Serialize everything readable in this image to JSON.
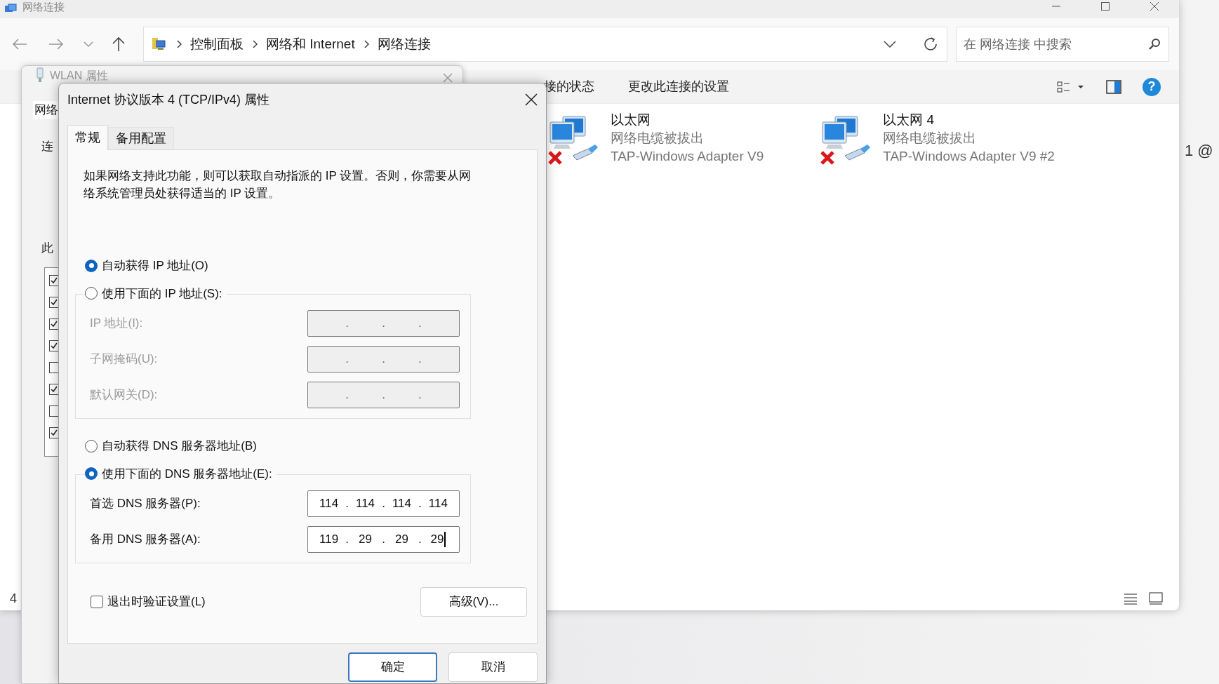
{
  "explorer": {
    "title": "网络连接",
    "breadcrumb": [
      "控制面板",
      "网络和 Internet",
      "网络连接"
    ],
    "search": {
      "placeholder": "在 网络连接 中搜索"
    },
    "commands": [
      "接的状态",
      "更改此连接的设置"
    ],
    "help_label": "?",
    "connections": [
      {
        "name": "以太网",
        "status": "网络电缆被拔出",
        "adapter": "TAP-Windows Adapter V9",
        "disconnected": true
      },
      {
        "name": "以太网 4",
        "status": "网络电缆被拔出",
        "adapter": "TAP-Windows Adapter V9 #2",
        "disconnected": true
      }
    ],
    "status_text": "4"
  },
  "background_text": "1 @",
  "wlan_dialog": {
    "title": "WLAN 属性",
    "tab": "网络",
    "labels": [
      "连",
      "此"
    ],
    "items": [
      {
        "checked": true
      },
      {
        "checked": true
      },
      {
        "checked": true
      },
      {
        "checked": true
      },
      {
        "checked": false
      },
      {
        "checked": true
      },
      {
        "checked": false
      },
      {
        "checked": true
      }
    ]
  },
  "ipv4_dialog": {
    "title": "Internet 协议版本 4 (TCP/IPv4) 属性",
    "tabs": [
      {
        "label": "常规",
        "selected": true
      },
      {
        "label": "备用配置",
        "selected": false
      }
    ],
    "description": "如果网络支持此功能，则可以获取自动指派的 IP 设置。否则，你需要从网络系统管理员处获得适当的 IP 设置。",
    "octet_separator": ".",
    "ip_mode": [
      {
        "label": "自动获得 IP 地址(O)",
        "selected": true
      },
      {
        "label": "使用下面的 IP 地址(S):",
        "selected": false
      }
    ],
    "ip_fields": [
      {
        "label": "IP 地址(I):",
        "disabled": true,
        "focused": false
      },
      {
        "label": "子网掩码(U):",
        "disabled": true,
        "focused": false
      },
      {
        "label": "默认网关(D):",
        "disabled": true,
        "focused": false
      }
    ],
    "dns_mode": [
      {
        "label": "自动获得 DNS 服务器地址(B)",
        "selected": false
      },
      {
        "label": "使用下面的 DNS 服务器地址(E):",
        "selected": true
      }
    ],
    "dns_fields": [
      {
        "label": "首选 DNS 服务器(P):",
        "octets": [
          "114",
          "114",
          "114",
          "114"
        ],
        "disabled": false,
        "focused": false
      },
      {
        "label": "备用 DNS 服务器(A):",
        "octets": [
          "119",
          "29",
          "29",
          "29"
        ],
        "disabled": false,
        "focused": true
      }
    ],
    "validate": {
      "label": "退出时验证设置(L)",
      "checked": false
    },
    "advanced_button": "高级(V)...",
    "buttons": [
      "确定",
      "取消"
    ]
  }
}
